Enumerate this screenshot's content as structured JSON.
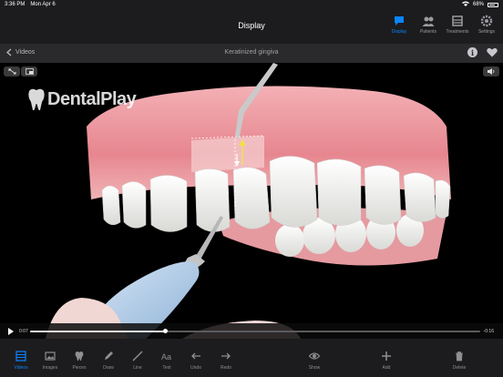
{
  "status": {
    "time": "3:36 PM",
    "date": "Mon Apr 6",
    "battery": "68%"
  },
  "header": {
    "title": "Display"
  },
  "nav_tabs": [
    {
      "label": "Display",
      "icon": "chat-bubble-icon",
      "active": true
    },
    {
      "label": "Patients",
      "icon": "people-icon",
      "active": false
    },
    {
      "label": "Treatments",
      "icon": "tray-icon",
      "active": false
    },
    {
      "label": "Settings",
      "icon": "gear-icon",
      "active": false
    }
  ],
  "subbar": {
    "back_label": "Videos",
    "title": "Keratinized gingiva"
  },
  "video": {
    "brand": "DentalPlay",
    "current_time": "0:07",
    "remaining_time": "-0:16",
    "progress": 0.3
  },
  "toolbar": {
    "items": [
      {
        "label": "Videos",
        "icon": "grid-icon",
        "active": true
      },
      {
        "label": "Images",
        "icon": "image-icon",
        "active": false
      },
      {
        "label": "Pieces",
        "icon": "tooth-icon",
        "active": false
      },
      {
        "label": "Draw",
        "icon": "pencil-icon",
        "active": false
      },
      {
        "label": "Line",
        "icon": "line-icon",
        "active": false
      },
      {
        "label": "Text",
        "icon": "text-icon",
        "active": false
      },
      {
        "label": "Undo",
        "icon": "arrow-left-icon",
        "active": false
      },
      {
        "label": "Redo",
        "icon": "arrow-right-icon",
        "active": false
      },
      {
        "label": "Show",
        "icon": "eye-icon",
        "active": false
      },
      {
        "label": "Add",
        "icon": "plus-icon",
        "active": false
      },
      {
        "label": "Delete",
        "icon": "trash-icon",
        "active": false
      }
    ]
  },
  "colors": {
    "accent": "#0a84ff",
    "gum": "#e8939a",
    "tooth": "#f2f2ee",
    "instrument": "#a8c8e8"
  }
}
